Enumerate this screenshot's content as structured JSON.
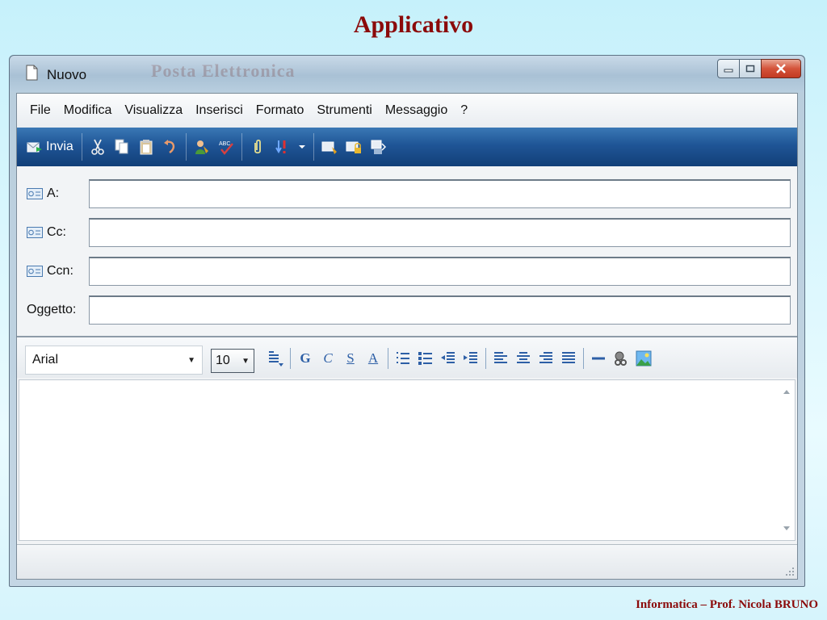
{
  "slide": {
    "title": "Applicativo",
    "footer": "Informatica – Prof. Nicola BRUNO"
  },
  "window": {
    "title": "Nuovo",
    "watermark": "Posta Elettronica",
    "controls": [
      "minimize-icon",
      "maximize-icon",
      "close-icon"
    ]
  },
  "menu": [
    "File",
    "Modifica",
    "Visualizza",
    "Inserisci",
    "Formato",
    "Strumenti",
    "Messaggio",
    "?"
  ],
  "toolbar": {
    "send_label": "Invia",
    "icons": [
      "cut-icon",
      "copy-icon",
      "paste-icon",
      "undo-icon",
      "address-book-icon",
      "spellcheck-icon",
      "attach-icon",
      "priority-icon",
      "priority-dropdown-icon",
      "sign-icon",
      "encrypt-icon",
      "offline-icon"
    ]
  },
  "fields": {
    "to_label": "A:",
    "cc_label": "Cc:",
    "bcc_label": "Ccn:",
    "subject_label": "Oggetto:",
    "to_value": "",
    "cc_value": "",
    "bcc_value": "",
    "subject_value": ""
  },
  "format_bar": {
    "font": "Arial",
    "size": "10",
    "bold": "G",
    "italic": "C",
    "underline": "S",
    "font_color": "A"
  },
  "colors": {
    "title_red": "#8b0a0a",
    "toolbar_blue": "#1f5596"
  }
}
